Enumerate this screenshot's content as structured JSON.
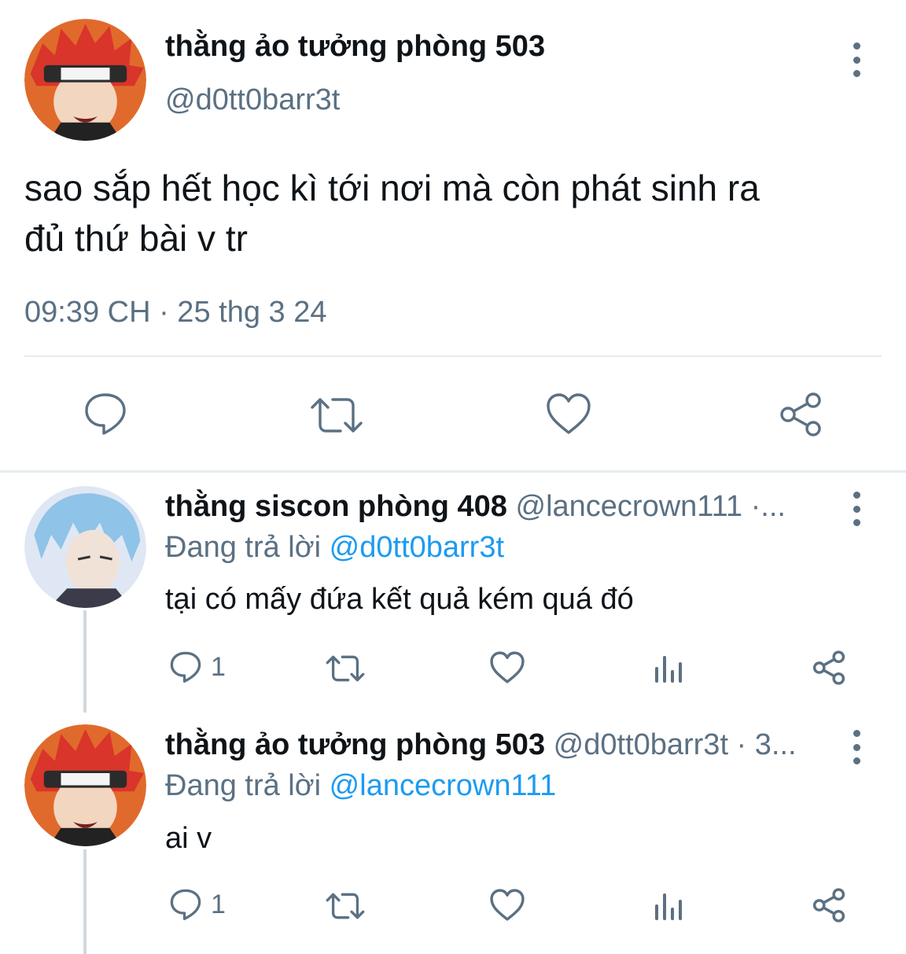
{
  "main_tweet": {
    "display_name": "thằng ảo tưởng phòng 503",
    "handle": "@d0tt0barr3t",
    "text_line1": "sao sắp hết học kì tới nơi mà còn phát sinh ra",
    "text_line2": "đủ thứ bài v tr",
    "timestamp": "09:39 CH · 25 thg 3 24",
    "actions": [
      "reply-icon",
      "retweet-icon",
      "like-icon",
      "share-icon"
    ]
  },
  "replies": [
    {
      "display_name": "thằng siscon phòng 408",
      "handle_meta": "@lancecrown111 ·...",
      "replying_prefix": "Đang trả lời",
      "replying_to": "@d0tt0barr3t",
      "text": "tại có mấy đứa kết quả kém quá đó",
      "reply_count": "1"
    },
    {
      "display_name": "thằng ảo tưởng phòng 503",
      "handle_meta": "@d0tt0barr3t · 3...",
      "replying_prefix": "Đang trả lời",
      "replying_to": "@lancecrown111",
      "text": "ai v",
      "reply_count": "1"
    }
  ],
  "colors": {
    "text": "#0f1419",
    "muted": "#5b7083",
    "link": "#1d9bf0",
    "divider": "#e6ecf0"
  }
}
